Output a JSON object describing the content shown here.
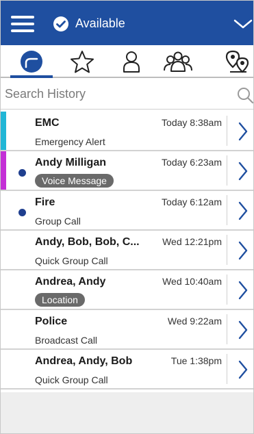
{
  "header": {
    "status_label": "Available",
    "status_icon": "check-circle-icon",
    "menu_icon": "hamburger-icon",
    "expand_icon": "chevron-down-icon",
    "background_color": "#1f4fa0"
  },
  "tabs": [
    {
      "name": "history",
      "icon": "history-icon",
      "selected": true
    },
    {
      "name": "favorites",
      "icon": "star-icon",
      "selected": false
    },
    {
      "name": "contacts",
      "icon": "person-icon",
      "selected": false
    },
    {
      "name": "groups",
      "icon": "group-icon",
      "selected": false
    },
    {
      "name": "map",
      "icon": "map-pins-icon",
      "selected": false
    }
  ],
  "search": {
    "placeholder": "Search History",
    "value": "",
    "icon": "search-icon"
  },
  "history": [
    {
      "name": "EMC",
      "subtitle": "Emergency Alert",
      "time": "Today 8:38am",
      "accent": "#21b6d6",
      "unread": false,
      "badge": false
    },
    {
      "name": "Andy Milligan",
      "subtitle": "Voice Message",
      "time": "Today 6:23am",
      "accent": "#c42fd6",
      "unread": true,
      "badge": true
    },
    {
      "name": "Fire",
      "subtitle": "Group Call",
      "time": "Today 6:12am",
      "accent": "",
      "unread": true,
      "badge": false
    },
    {
      "name": "Andy, Bob, Bob, C...",
      "subtitle": "Quick Group Call",
      "time": "Wed 12:21pm",
      "accent": "",
      "unread": false,
      "badge": false
    },
    {
      "name": "Andrea, Andy",
      "subtitle": "Location",
      "time": "Wed 10:40am",
      "accent": "",
      "unread": false,
      "badge": true
    },
    {
      "name": "Police",
      "subtitle": "Broadcast Call",
      "time": "Wed 9:22am",
      "accent": "",
      "unread": false,
      "badge": false
    },
    {
      "name": "Andrea, Andy, Bob",
      "subtitle": "Quick Group Call",
      "time": "Tue 1:38pm",
      "accent": "",
      "unread": false,
      "badge": false
    }
  ]
}
